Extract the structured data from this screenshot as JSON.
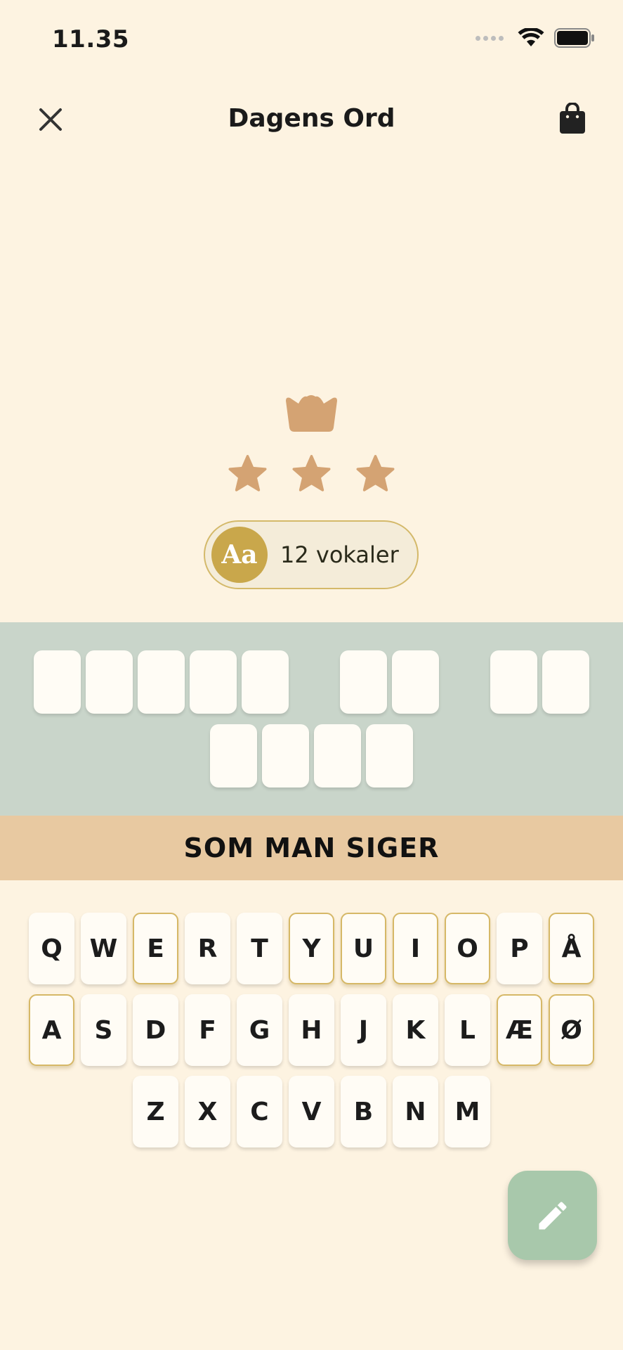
{
  "status_bar": {
    "time": "11.35"
  },
  "header": {
    "title": "Dagens Ord"
  },
  "hint": {
    "badge": "Aa",
    "text": "12 vokaler"
  },
  "board": {
    "row1_groups": [
      5,
      2,
      2
    ],
    "row2_groups": [
      4
    ]
  },
  "clue": {
    "text": "SOM MAN SIGER"
  },
  "keyboard": {
    "row1": [
      "Q",
      "W",
      "E",
      "R",
      "T",
      "Y",
      "U",
      "I",
      "O",
      "P",
      "Å"
    ],
    "row2": [
      "A",
      "S",
      "D",
      "F",
      "G",
      "H",
      "J",
      "K",
      "L",
      "Æ",
      "Ø"
    ],
    "row3": [
      "Z",
      "X",
      "C",
      "V",
      "B",
      "N",
      "M"
    ],
    "vowels": [
      "E",
      "Y",
      "U",
      "I",
      "O",
      "Å",
      "A",
      "Æ",
      "Ø"
    ]
  },
  "colors": {
    "background": "#FDF3E1",
    "board": "#C9D5CA",
    "clue_bar": "#E8C9A1",
    "accent_gold": "#C9A74B",
    "trophy": "#D4A373",
    "fab": "#A8C8AB"
  },
  "icons": {
    "close": "close-icon",
    "bag": "shopping-bag-icon",
    "crown": "crown-icon",
    "star": "star-icon",
    "pencil": "pencil-icon"
  }
}
